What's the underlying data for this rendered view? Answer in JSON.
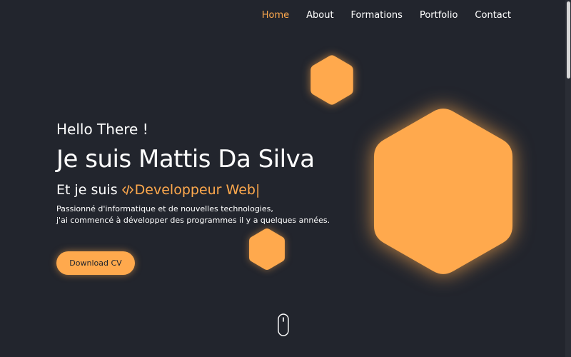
{
  "nav": {
    "items": [
      {
        "label": "Home",
        "active": true
      },
      {
        "label": "About",
        "active": false
      },
      {
        "label": "Formations",
        "active": false
      },
      {
        "label": "Portfolio",
        "active": false
      },
      {
        "label": "Contact",
        "active": false
      }
    ]
  },
  "hero": {
    "greeting": "Hello There !",
    "name": "Je suis Mattis Da Silva",
    "role_prefix": "Et je suis ",
    "role": "Developpeur Web|",
    "description_line1": "Passionné d'informatique et de nouvelles technologies,",
    "description_line2": "j'ai commencé à développer des programmes il y a quelques années.",
    "cv_button_label": "Download CV"
  },
  "icons": {
    "role_icon": "code-icon",
    "scroll_icon": "mouse-icon"
  },
  "colors": {
    "background": "#22252d",
    "accent": "#ffa94d",
    "text": "#ffffff"
  }
}
